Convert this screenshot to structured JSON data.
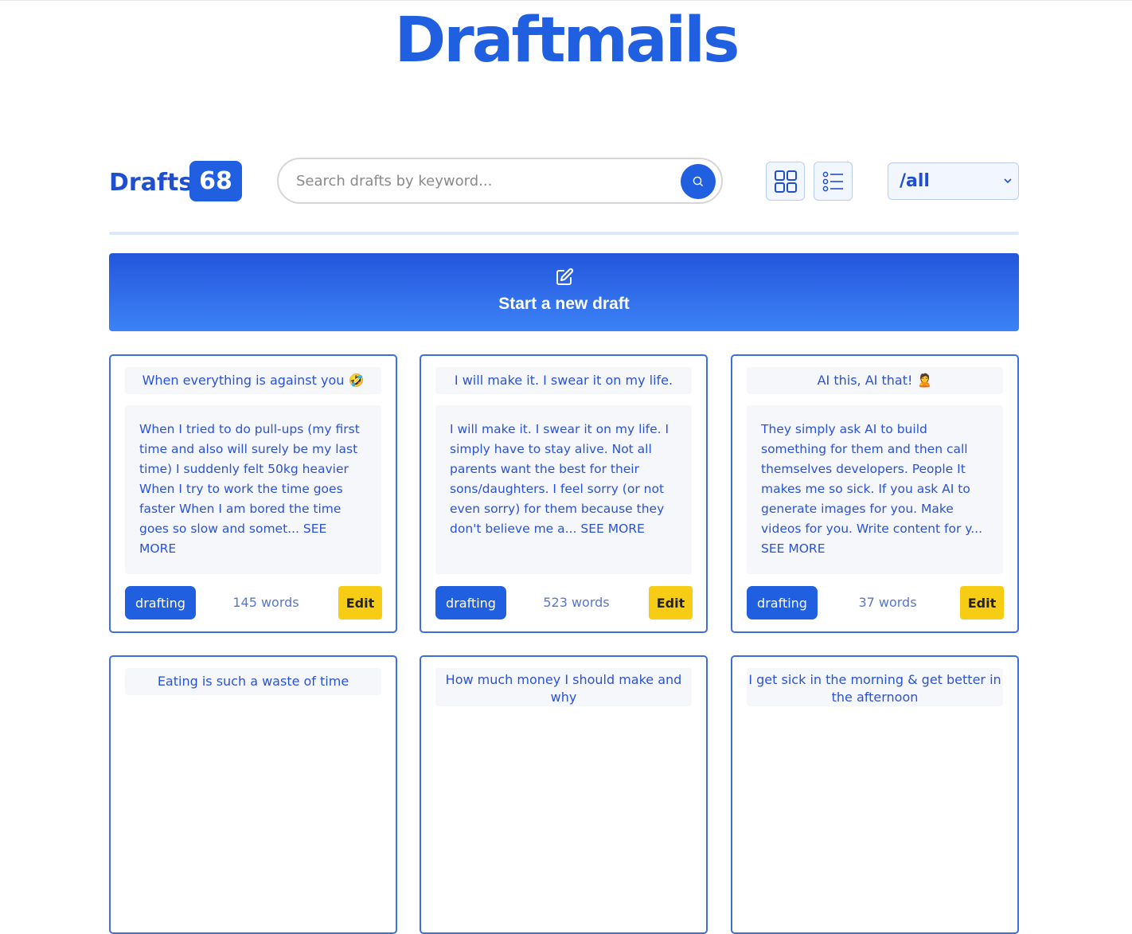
{
  "app": {
    "logo": "Draftmails"
  },
  "toolbar": {
    "drafts_label": "Drafts",
    "drafts_count": "68",
    "search_placeholder": "Search drafts by keyword...",
    "filter_value": "/all"
  },
  "new_draft": {
    "label": "Start a new draft"
  },
  "colors": {
    "primary": "#1f5fe0",
    "edit": "#f7cc15",
    "card_border": "#3d6fe2"
  },
  "cards": [
    {
      "title": "When everything is against you 🤣",
      "body": "When I tried to do pull-ups (my first time and also will surely be my last time) I suddenly felt 50kg heavier When I try to work the time goes faster When I am bored the time goes so slow and somet...",
      "see_more": "SEE MORE",
      "status": "drafting",
      "words": "145 words",
      "edit": "Edit"
    },
    {
      "title": "I will make it. I swear it on my life.",
      "body": "I will make it. I swear it on my life. I simply have to stay alive. Not all parents want the best for their sons/daughters. I feel sorry (or not even sorry) for them because they don't believe me a...",
      "see_more": "SEE MORE",
      "status": "drafting",
      "words": "523 words",
      "edit": "Edit"
    },
    {
      "title": "AI this, AI that! 🙎",
      "body": "They simply ask AI to build something for them and then call themselves developers. People It makes me so sick. If you ask AI to generate images for you. Make videos for you. Write content for y...",
      "see_more": "SEE MORE",
      "status": "drafting",
      "words": "37 words",
      "edit": "Edit"
    },
    {
      "title": "Eating is such a waste of time"
    },
    {
      "title": "How much money I should make and why"
    },
    {
      "title": "I get sick in the morning & get better in the afternoon"
    }
  ]
}
